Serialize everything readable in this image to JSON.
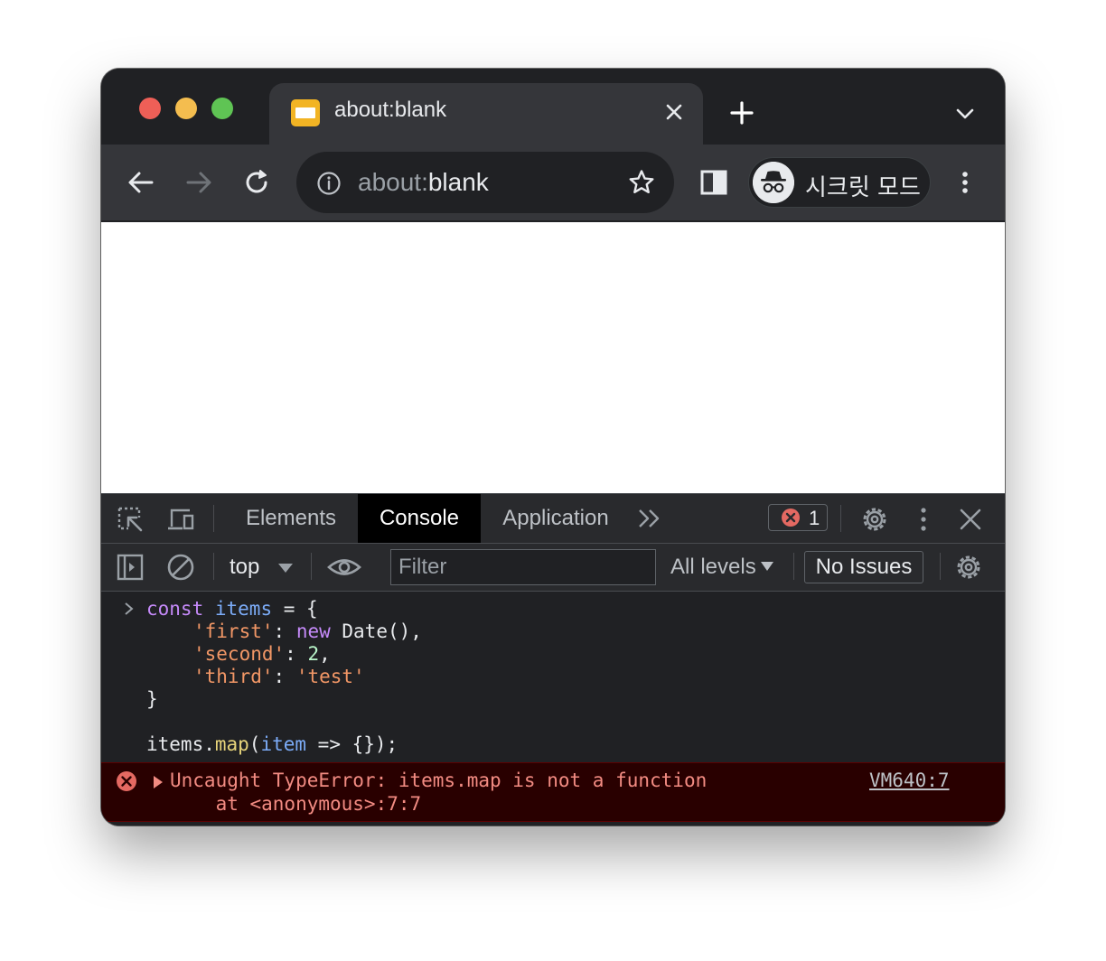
{
  "browser": {
    "tab_title": "about:blank",
    "address": {
      "scheme_part": "about:",
      "rest_part": "blank"
    },
    "incognito_label": "시크릿 모드"
  },
  "devtools": {
    "tabs": [
      "Elements",
      "Console",
      "Application"
    ],
    "active_tab": "Console",
    "error_count": "1",
    "context": "top",
    "filter_placeholder": "Filter",
    "levels": "All levels",
    "issues": "No Issues"
  },
  "console": {
    "code": {
      "l1_kw": "const",
      "l1_var": "items",
      "l1_rest": " = {",
      "l2_key": "'first'",
      "l2_colon": ": ",
      "l2_kw": "new",
      "l2_rest": " Date(),",
      "l3_key": "'second'",
      "l3_colon": ": ",
      "l3_num": "2",
      "l3_rest": ",",
      "l4_key": "'third'",
      "l4_colon": ": ",
      "l4_str": "'test'",
      "l5": "}",
      "l7_a": "items.",
      "l7_fn": "map",
      "l7_b": "(",
      "l7_var": "item",
      "l7_c": " => {});"
    },
    "error": {
      "message": "Uncaught TypeError: items.map is not a function",
      "location": "    at <anonymous>:7:7",
      "source": "VM640:7"
    }
  },
  "colors": {
    "error_text": "#f28b82",
    "error_background": "#290000",
    "keyword": "#c58af9",
    "string": "#f29766"
  }
}
